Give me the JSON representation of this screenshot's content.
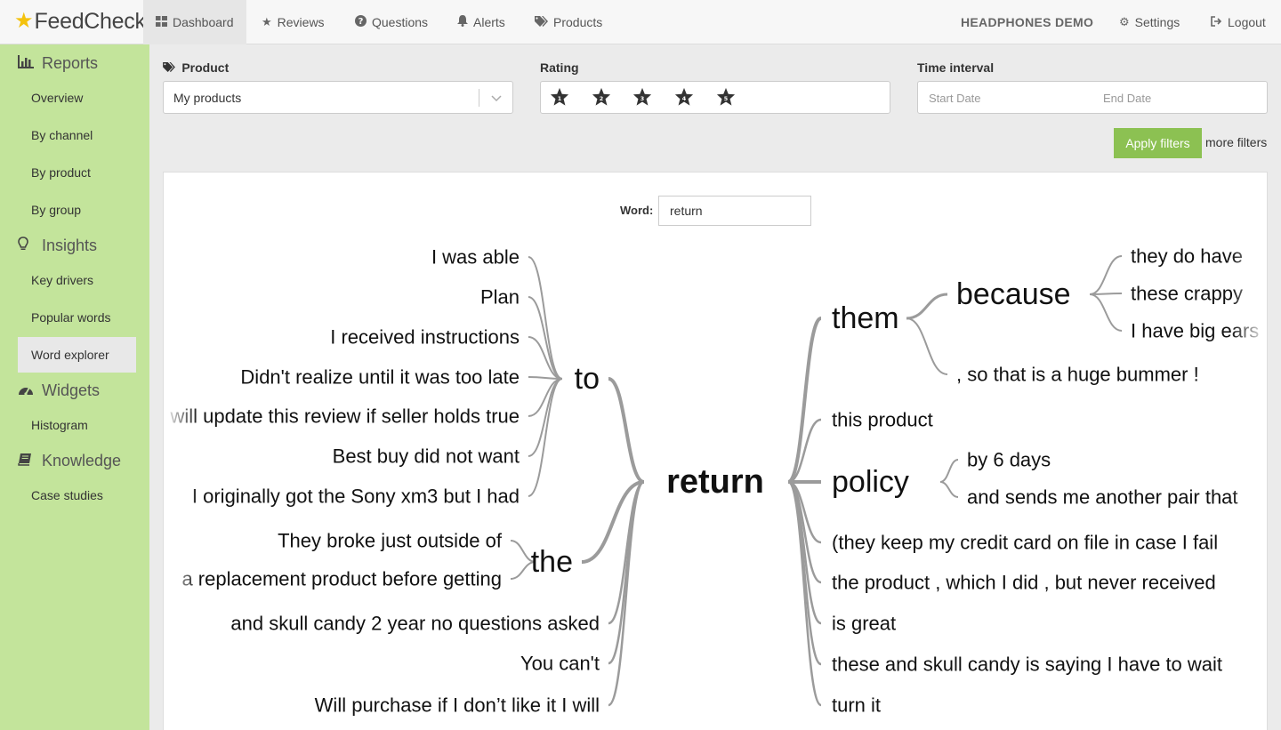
{
  "app": {
    "logo": "FeedCheck"
  },
  "nav": {
    "items": [
      {
        "label": "Dashboard",
        "icon": "dashboard-icon"
      },
      {
        "label": "Reviews",
        "icon": "star-icon"
      },
      {
        "label": "Questions",
        "icon": "question-icon"
      },
      {
        "label": "Alerts",
        "icon": "bell-icon"
      },
      {
        "label": "Products",
        "icon": "tags-icon"
      }
    ],
    "account": "HEADPHONES DEMO",
    "settings": "Settings",
    "logout": "Logout"
  },
  "sidebar": {
    "reports": {
      "label": "Reports",
      "items": [
        "Overview",
        "By channel",
        "By product",
        "By group"
      ]
    },
    "insights": {
      "label": "Insights",
      "items": [
        "Key drivers",
        "Popular words",
        "Word explorer"
      ]
    },
    "widgets": {
      "label": "Widgets",
      "items": [
        "Histogram"
      ]
    },
    "knowledge": {
      "label": "Knowledge",
      "items": [
        "Case studies"
      ]
    }
  },
  "filters": {
    "product_label": "Product",
    "product_value": "My products",
    "rating_label": "Rating",
    "rating_stars": [
      "1",
      "2",
      "3",
      "4",
      "5"
    ],
    "interval_label": "Time interval",
    "start_placeholder": "Start Date",
    "end_placeholder": "End Date",
    "apply": "Apply filters",
    "more": "more filters"
  },
  "explorer": {
    "word_label": "Word:",
    "word_value": "return",
    "root": "return",
    "left": [
      {
        "word": "to",
        "children": [
          "I was able",
          "Plan",
          "I received instructions",
          "Didn't realize until it was too late",
          "I will update this review if seller holds true",
          "Best buy did not want",
          "I originally got the Sony xm3 but I had"
        ]
      },
      {
        "word": "the",
        "children": [
          "They broke just outside of",
          "a replacement product before getting"
        ]
      },
      {
        "word": "",
        "children": [
          "and skull candy 2 year no questions asked",
          "You can't",
          "Will purchase if I don’t like it I will"
        ]
      }
    ],
    "right": [
      {
        "word": "them",
        "children": [
          {
            "word": "because",
            "children": [
              "they do have",
              "these crappy",
              "I have big ears"
            ]
          },
          {
            "word": ", so that is a huge bummer !",
            "children": []
          }
        ]
      },
      {
        "word": "this product",
        "children": []
      },
      {
        "word": "policy",
        "children": [
          {
            "word": "by 6 days",
            "children": []
          },
          {
            "word": "and sends me another pair that",
            "children": []
          }
        ]
      },
      {
        "word": "(they keep my credit card on file in case I fail",
        "children": []
      },
      {
        "word": "the product , which I did , but never received",
        "children": []
      },
      {
        "word": "is great",
        "children": []
      },
      {
        "word": "these and skull candy is saying I have to wait",
        "children": []
      },
      {
        "word": "turn it",
        "children": []
      }
    ]
  }
}
